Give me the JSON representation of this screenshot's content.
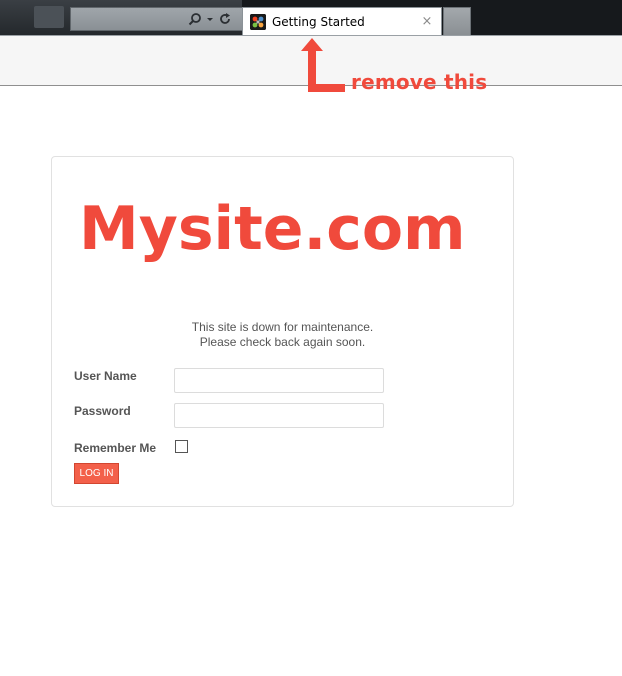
{
  "browser": {
    "active_tab": {
      "title": "Getting Started",
      "close_glyph": "×",
      "favicon": "joomla-favicon"
    },
    "address_bar_icons": [
      "search-icon",
      "dropdown-arrow-icon",
      "reload-icon"
    ]
  },
  "annotation": {
    "text": "remove this",
    "color": "#f04a3c"
  },
  "login": {
    "logo_text": "Mysite.com",
    "message_line1": "This site is down for maintenance.",
    "message_line2": "Please check back again soon.",
    "username_label": "User Name",
    "username_value": "",
    "password_label": "Password",
    "password_value": "",
    "remember_label": "Remember Me",
    "remember_checked": false,
    "button_label": "LOG IN",
    "accent_color": "#f04a3c",
    "button_color": "#f3604a"
  }
}
